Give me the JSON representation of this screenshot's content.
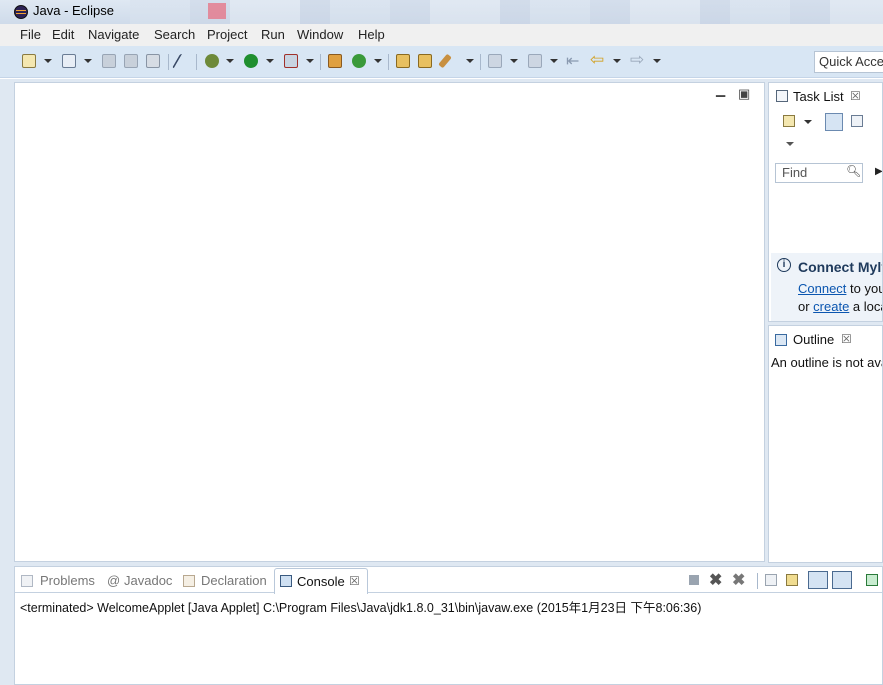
{
  "window": {
    "title": "Java - Eclipse"
  },
  "menu": [
    "File",
    "Edit",
    "Navigate",
    "Search",
    "Project",
    "Run",
    "Window",
    "Help"
  ],
  "toolbar": {
    "quick_access": "Quick Access"
  },
  "editor": {
    "minimize": "▭",
    "maximize": "□"
  },
  "task_list": {
    "title": "Task List",
    "find_placeholder": "Find",
    "connect_title": "Connect Mylyn",
    "connect_link": "Connect",
    "connect_text": " to your",
    "create_prefix": "or ",
    "create_link": "create",
    "create_text": " a local"
  },
  "outline": {
    "title": "Outline",
    "message": "An outline is not available."
  },
  "bottom_tabs": [
    "Problems",
    "Javadoc",
    "Declaration",
    "Console"
  ],
  "console": {
    "line": "<terminated> WelcomeApplet [Java Applet] C:\\Program Files\\Java\\jdk1.8.0_31\\bin\\javaw.exe (2015年1月23日 下午8:06:36)"
  },
  "colors": {
    "toolbar_bg": "#d8e6f4",
    "workbench_bg": "#dfe8f2",
    "link": "#0b56b0",
    "run_green": "#1f8f2f"
  }
}
